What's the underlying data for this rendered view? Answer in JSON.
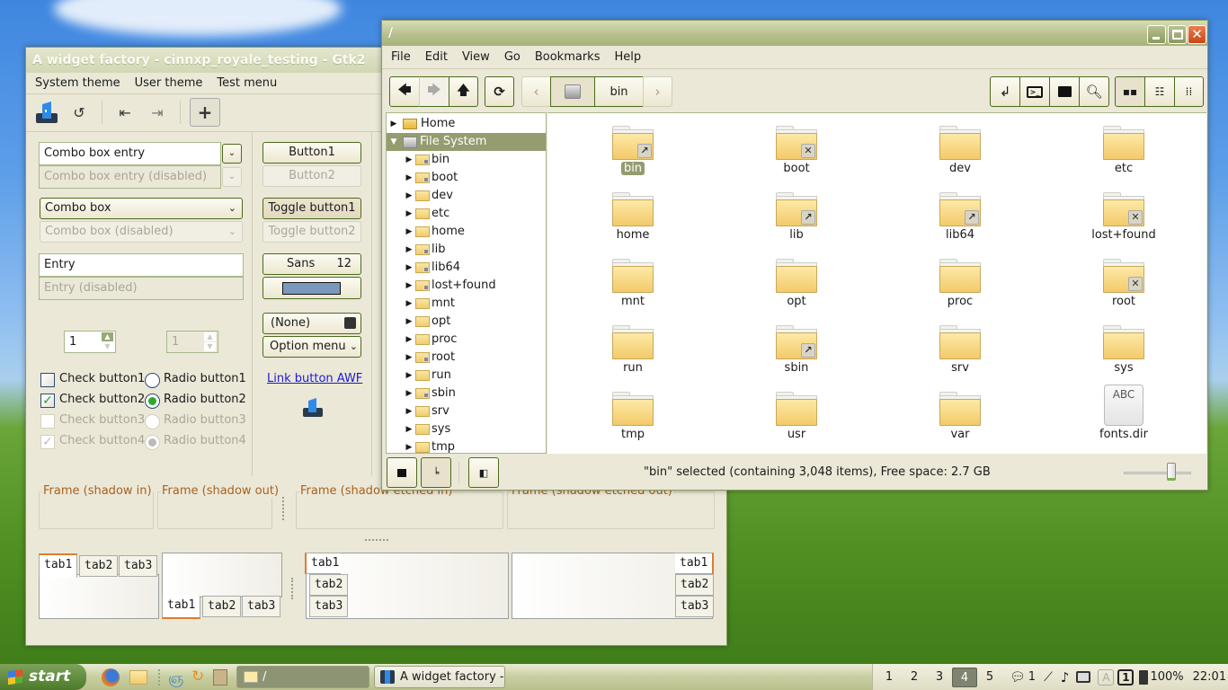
{
  "desktop": {
    "wallpaper": "green hills and blue sky"
  },
  "widget_factory": {
    "title": "A widget factory - cinnxp_royale_testing - Gtk2",
    "menu": [
      "System theme",
      "User theme",
      "Test menu"
    ],
    "toolbar_icons": [
      "app-icon",
      "refresh-icon",
      "goto-first-icon",
      "goto-last-icon",
      "add-icon"
    ],
    "combo_entry": {
      "value": "Combo box entry",
      "disabled_value": "Combo box entry (disabled)"
    },
    "combo": {
      "value": "Combo box",
      "disabled_value": "Combo box (disabled)"
    },
    "entry": {
      "value": "Entry",
      "disabled_value": "Entry (disabled)"
    },
    "spin": {
      "value": "1",
      "disabled_value": "1"
    },
    "checks": [
      {
        "label": "Check button1",
        "checked": false,
        "disabled": false
      },
      {
        "label": "Check button2",
        "checked": true,
        "disabled": false
      },
      {
        "label": "Check button3",
        "checked": false,
        "disabled": true
      },
      {
        "label": "Check button4",
        "checked": true,
        "disabled": true
      }
    ],
    "radios": [
      {
        "label": "Radio button1",
        "selected": false,
        "disabled": false
      },
      {
        "label": "Radio button2",
        "selected": true,
        "disabled": false
      },
      {
        "label": "Radio button3",
        "selected": false,
        "disabled": true
      },
      {
        "label": "Radio button4",
        "selected": true,
        "disabled": true
      }
    ],
    "buttons": {
      "button1": "Button1",
      "button2": "Button2",
      "toggle1": "Toggle button1",
      "toggle2": "Toggle button2",
      "font_name": "Sans",
      "font_size": "12",
      "color_swatch": "#7a98bc",
      "file_chooser": "(None)",
      "option_menu": "Option menu",
      "link": "Link button AWF"
    },
    "frames": [
      "Frame (shadow in)",
      "Frame (shadow out)",
      "Frame (shadow etched in)",
      "Frame (shadow etched out)"
    ],
    "tabs": [
      "tab1",
      "tab2",
      "tab3"
    ]
  },
  "file_manager": {
    "title": "/",
    "menu": [
      "File",
      "Edit",
      "View",
      "Go",
      "Bookmarks",
      "Help"
    ],
    "path_current": "bin",
    "sidebar": {
      "places": [
        {
          "label": "Home",
          "icon": "home-folder-icon"
        },
        {
          "label": "File System",
          "icon": "drive-icon",
          "selected": true
        }
      ],
      "tree": [
        "bin",
        "boot",
        "dev",
        "etc",
        "home",
        "lib",
        "lib64",
        "lost+found",
        "mnt",
        "opt",
        "proc",
        "root",
        "run",
        "sbin",
        "srv",
        "sys",
        "tmp"
      ],
      "emblems": {
        "bin": "link",
        "boot": "locked",
        "lib": "link",
        "lib64": "link",
        "lost+found": "locked",
        "root": "locked",
        "sbin": "link"
      }
    },
    "items": [
      {
        "name": "bin",
        "emblem": "link",
        "selected": true
      },
      {
        "name": "boot",
        "emblem": "locked"
      },
      {
        "name": "dev"
      },
      {
        "name": "etc"
      },
      {
        "name": "home"
      },
      {
        "name": "lib",
        "emblem": "link"
      },
      {
        "name": "lib64",
        "emblem": "link"
      },
      {
        "name": "lost+found",
        "emblem": "locked"
      },
      {
        "name": "mnt"
      },
      {
        "name": "opt"
      },
      {
        "name": "proc"
      },
      {
        "name": "root",
        "emblem": "locked"
      },
      {
        "name": "run"
      },
      {
        "name": "sbin",
        "emblem": "link"
      },
      {
        "name": "srv"
      },
      {
        "name": "sys"
      },
      {
        "name": "tmp"
      },
      {
        "name": "usr"
      },
      {
        "name": "var"
      },
      {
        "name": "fonts.dir",
        "type": "font-file",
        "preview": "ABC"
      }
    ],
    "status": "\"bin\" selected (containing 3,048 items), Free space: 2.7 GB",
    "zoom_level": 0.7
  },
  "taskbar": {
    "start_label": "start",
    "tasks": [
      {
        "label": "/",
        "active": true
      },
      {
        "label": "A widget factory - c...",
        "active": false
      }
    ],
    "workspaces": [
      "1",
      "2",
      "3",
      "4",
      "5"
    ],
    "active_workspace": "4",
    "notifications": "1",
    "keyboard_layout": "1",
    "battery": "100%",
    "clock": "22:01"
  }
}
